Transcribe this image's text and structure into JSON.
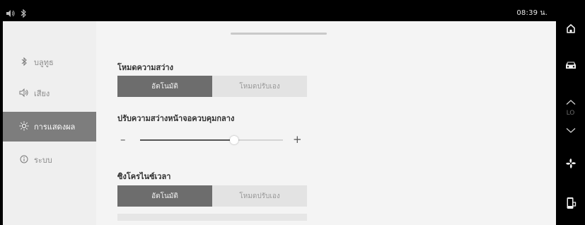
{
  "status": {
    "icons": [
      "speaker-icon",
      "bluetooth-icon"
    ],
    "time": "08:39 น."
  },
  "sidebar": {
    "items": [
      {
        "label": "บลูทูธ",
        "icon": "bluetooth-icon",
        "active": false
      },
      {
        "label": "เสียง",
        "icon": "speaker-icon",
        "active": false
      },
      {
        "label": "การแสดงผล",
        "icon": "sun-icon",
        "active": true
      },
      {
        "label": "ระบบ",
        "icon": "info-icon",
        "active": false
      }
    ]
  },
  "display": {
    "brightness_mode": {
      "label": "โหมดความสว่าง",
      "options": [
        "อัตโนมัติ",
        "โหมดปรับเอง"
      ],
      "selected": "อัตโนมัติ"
    },
    "center_brightness": {
      "label": "ปรับความสว่างหน้าจอควบคุมกลาง",
      "minus": "–",
      "plus": "+",
      "level": 0.66
    },
    "time_sync": {
      "label": "ซิงโครไนซ์เวลา",
      "options": [
        "อัตโนมัติ",
        "โหมดปรับเอง"
      ],
      "selected": "อัตโนมัติ"
    }
  },
  "rail": {
    "temp_label": "LO",
    "icons": [
      "home-icon",
      "car-icon",
      "chevron-up-icon",
      "chevron-down-icon",
      "fan-icon",
      "phone-settings-icon"
    ]
  },
  "colors": {
    "panel": "#f4f4f4",
    "active_nav": "#7d7d7d",
    "selected_segment": "#6d6d6d"
  }
}
